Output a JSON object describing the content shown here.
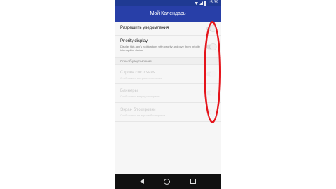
{
  "status_bar": {
    "time": "15:39",
    "icons": [
      "wifi-icon",
      "signal-icon",
      "battery-icon"
    ]
  },
  "app_bar": {
    "title": "Мой Календарь"
  },
  "settings": {
    "allow_notifications": {
      "title": "Разрешить уведомления",
      "toggle_on": false
    },
    "priority_display": {
      "title": "Priority display",
      "description": "Display this app's notifications with priority and give them priority interruption status",
      "toggle_on": false
    },
    "section_header": "Способ уведомления",
    "status_bar": {
      "title": "Строка состояния",
      "description": "Отображать в строке состояния",
      "toggle_on": false
    },
    "banners": {
      "title": "Баннеры",
      "description": "Отображать вверху на экране",
      "toggle_on": false
    },
    "lock_screen": {
      "title": "Экран блокировки",
      "description": "Отображать на экране блокировки",
      "toggle_on": false
    }
  },
  "colors": {
    "app_bar": "#283fa8",
    "annotation": "#e5141b"
  }
}
